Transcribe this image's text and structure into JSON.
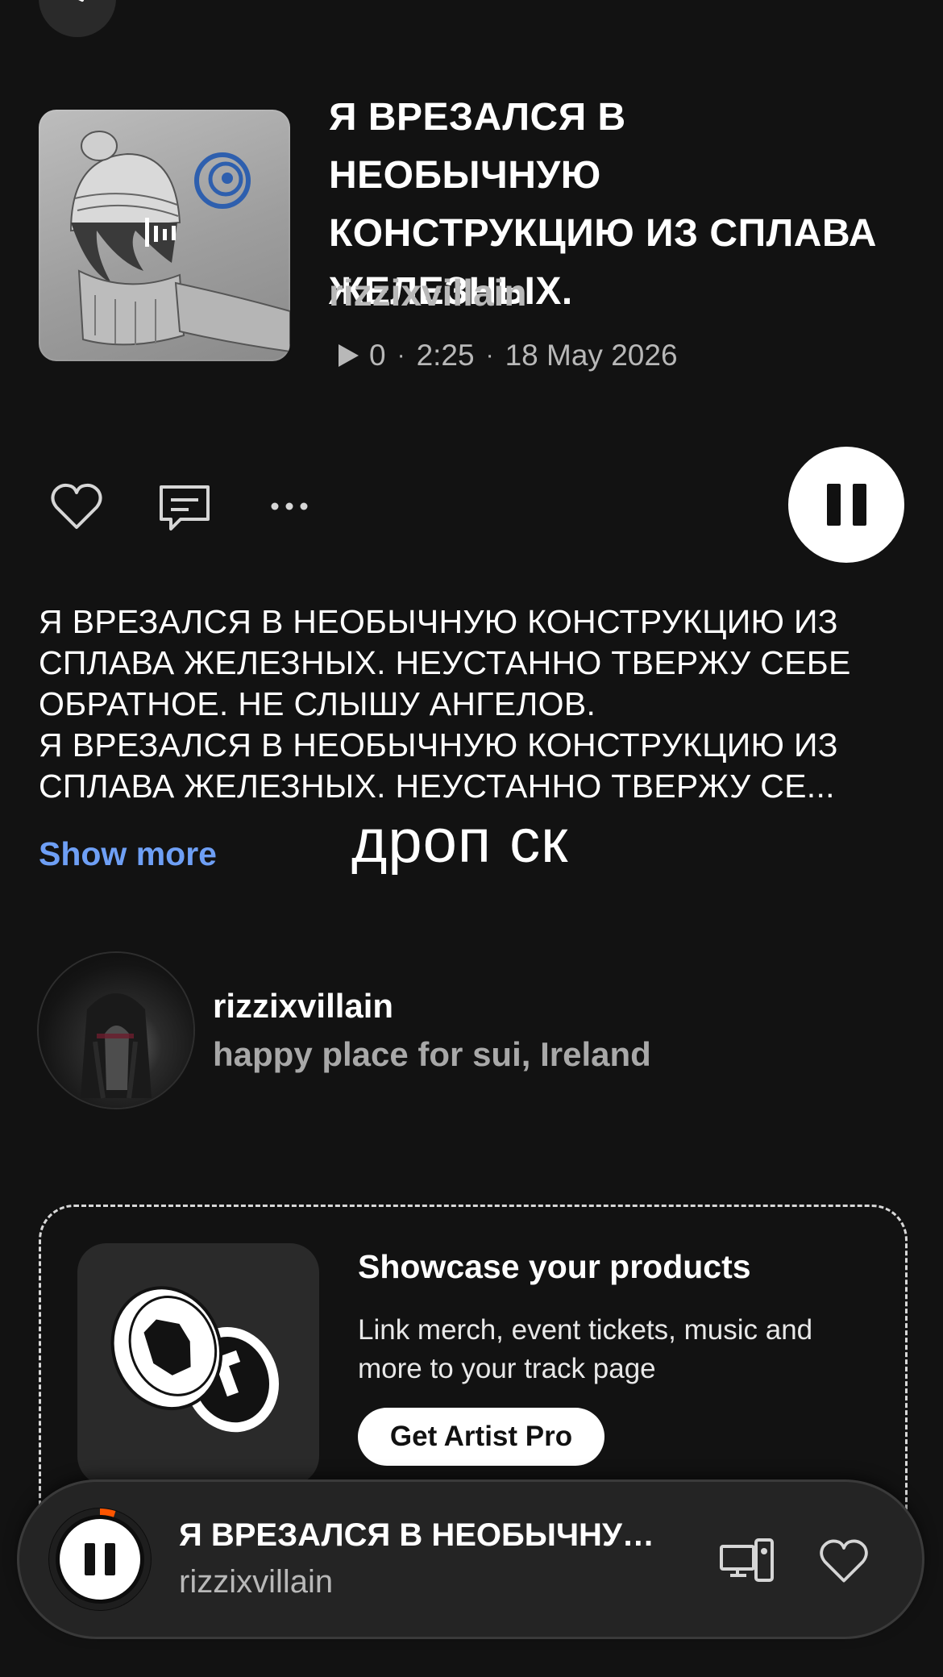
{
  "track": {
    "title": "Я ВРЕЗАЛСЯ В НЕОБЫЧНУЮ КОНСТРУКЦИЮ ИЗ СПЛАВА ЖЕЛЕЗНЫХ.",
    "artist": "rizzixvillain",
    "plays": "0",
    "duration": "2:25",
    "date": "18 May 2026"
  },
  "description": {
    "text": "Я ВРЕЗАЛСЯ В НЕОБЫЧНУЮ КОНСТРУКЦИЮ ИЗ\nСПЛАВА ЖЕЛЕЗНЫХ. НЕУСТАННО ТВЕРЖУ СЕБЕ\nОБРАТНОЕ. НЕ СЛЫШУ АНГЕЛОВ.\nЯ ВРЕЗАЛСЯ В НЕОБЫЧНУЮ КОНСТРУКЦИЮ ИЗ\nСПЛАВА ЖЕЛЕЗНЫХ. НЕУСТАННО ТВЕРЖУ СЕ...",
    "show_more_label": "Show more"
  },
  "overlay_text": "дроп ск",
  "artist_card": {
    "name": "rizzixvillain",
    "location": "happy place for sui, Ireland"
  },
  "promo": {
    "title": "Showcase your products",
    "text": "Link merch, event tickets, music and more to your track page",
    "button_label": "Get Artist Pro"
  },
  "mini_player": {
    "title": "Я ВРЕЗАЛСЯ В НЕОБЫЧНУЮ КОНСТРУКЦИЮ ИЗ СПЛАВА ЖЕЛЕЗНЫХ.",
    "artist": "rizzixvillain",
    "progress": 0.05
  },
  "colors": {
    "background": "#121212",
    "link": "#6e9ff5",
    "progress": "#ff5500"
  },
  "icons": {
    "back": "chevron-left-icon",
    "like": "heart-icon",
    "comment": "comment-icon",
    "more": "more-horizontal-icon",
    "pause": "pause-icon",
    "device": "device-connect-icon",
    "play_count": "play-icon"
  }
}
